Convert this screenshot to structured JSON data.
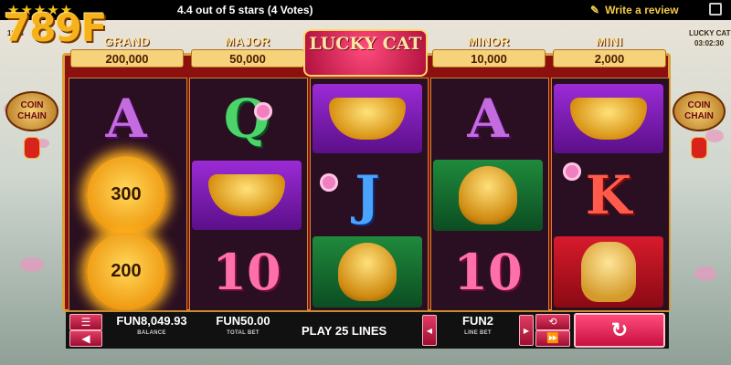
{
  "header": {
    "stars": "★★★★★",
    "rating_text": "4.4 out of 5 stars (4 Votes)",
    "review_icon": "pencil-icon",
    "review_label": "Write a review",
    "expand_icon": "fullscreen-icon"
  },
  "brand": {
    "logo_text": "789F",
    "logo_color": "#f6b21a"
  },
  "game": {
    "title": "LUCKY CAT",
    "id_text": "1073",
    "corner_title": "LUCKY CAT",
    "clock": "03:02:30",
    "side_badge": "COIN CHAIN"
  },
  "jackpots": [
    {
      "name": "GRAND",
      "value": "200,000"
    },
    {
      "name": "MAJOR",
      "value": "50,000"
    },
    {
      "name": "MINOR",
      "value": "10,000"
    },
    {
      "name": "MINI",
      "value": "2,000"
    }
  ],
  "reels": [
    [
      "A",
      "300",
      "200"
    ],
    [
      "Q",
      "ingot",
      "10"
    ],
    [
      "ingot",
      "J",
      "buddha"
    ],
    [
      "A",
      "buddha",
      "10"
    ],
    [
      "ingot",
      "K",
      "lucky-cat"
    ]
  ],
  "controls": {
    "menu_icon": "menu-icon",
    "sound_icon": "speaker-icon",
    "balance_value": "FUN8,049.93",
    "balance_label": "BALANCE",
    "total_bet_value": "FUN50.00",
    "total_bet_label": "TOTAL BET",
    "play_lines": "PLAY 25 LINES",
    "line_bet_value": "FUN2",
    "line_bet_label": "LINE BET",
    "autoplay_icon": "autoplay-icon",
    "turbo_icon": "fast-forward-icon",
    "spin_icon": "spin-icon"
  },
  "colors": {
    "accent": "#e23b63",
    "frame": "#8c1010",
    "gold": "#d9a23a"
  }
}
